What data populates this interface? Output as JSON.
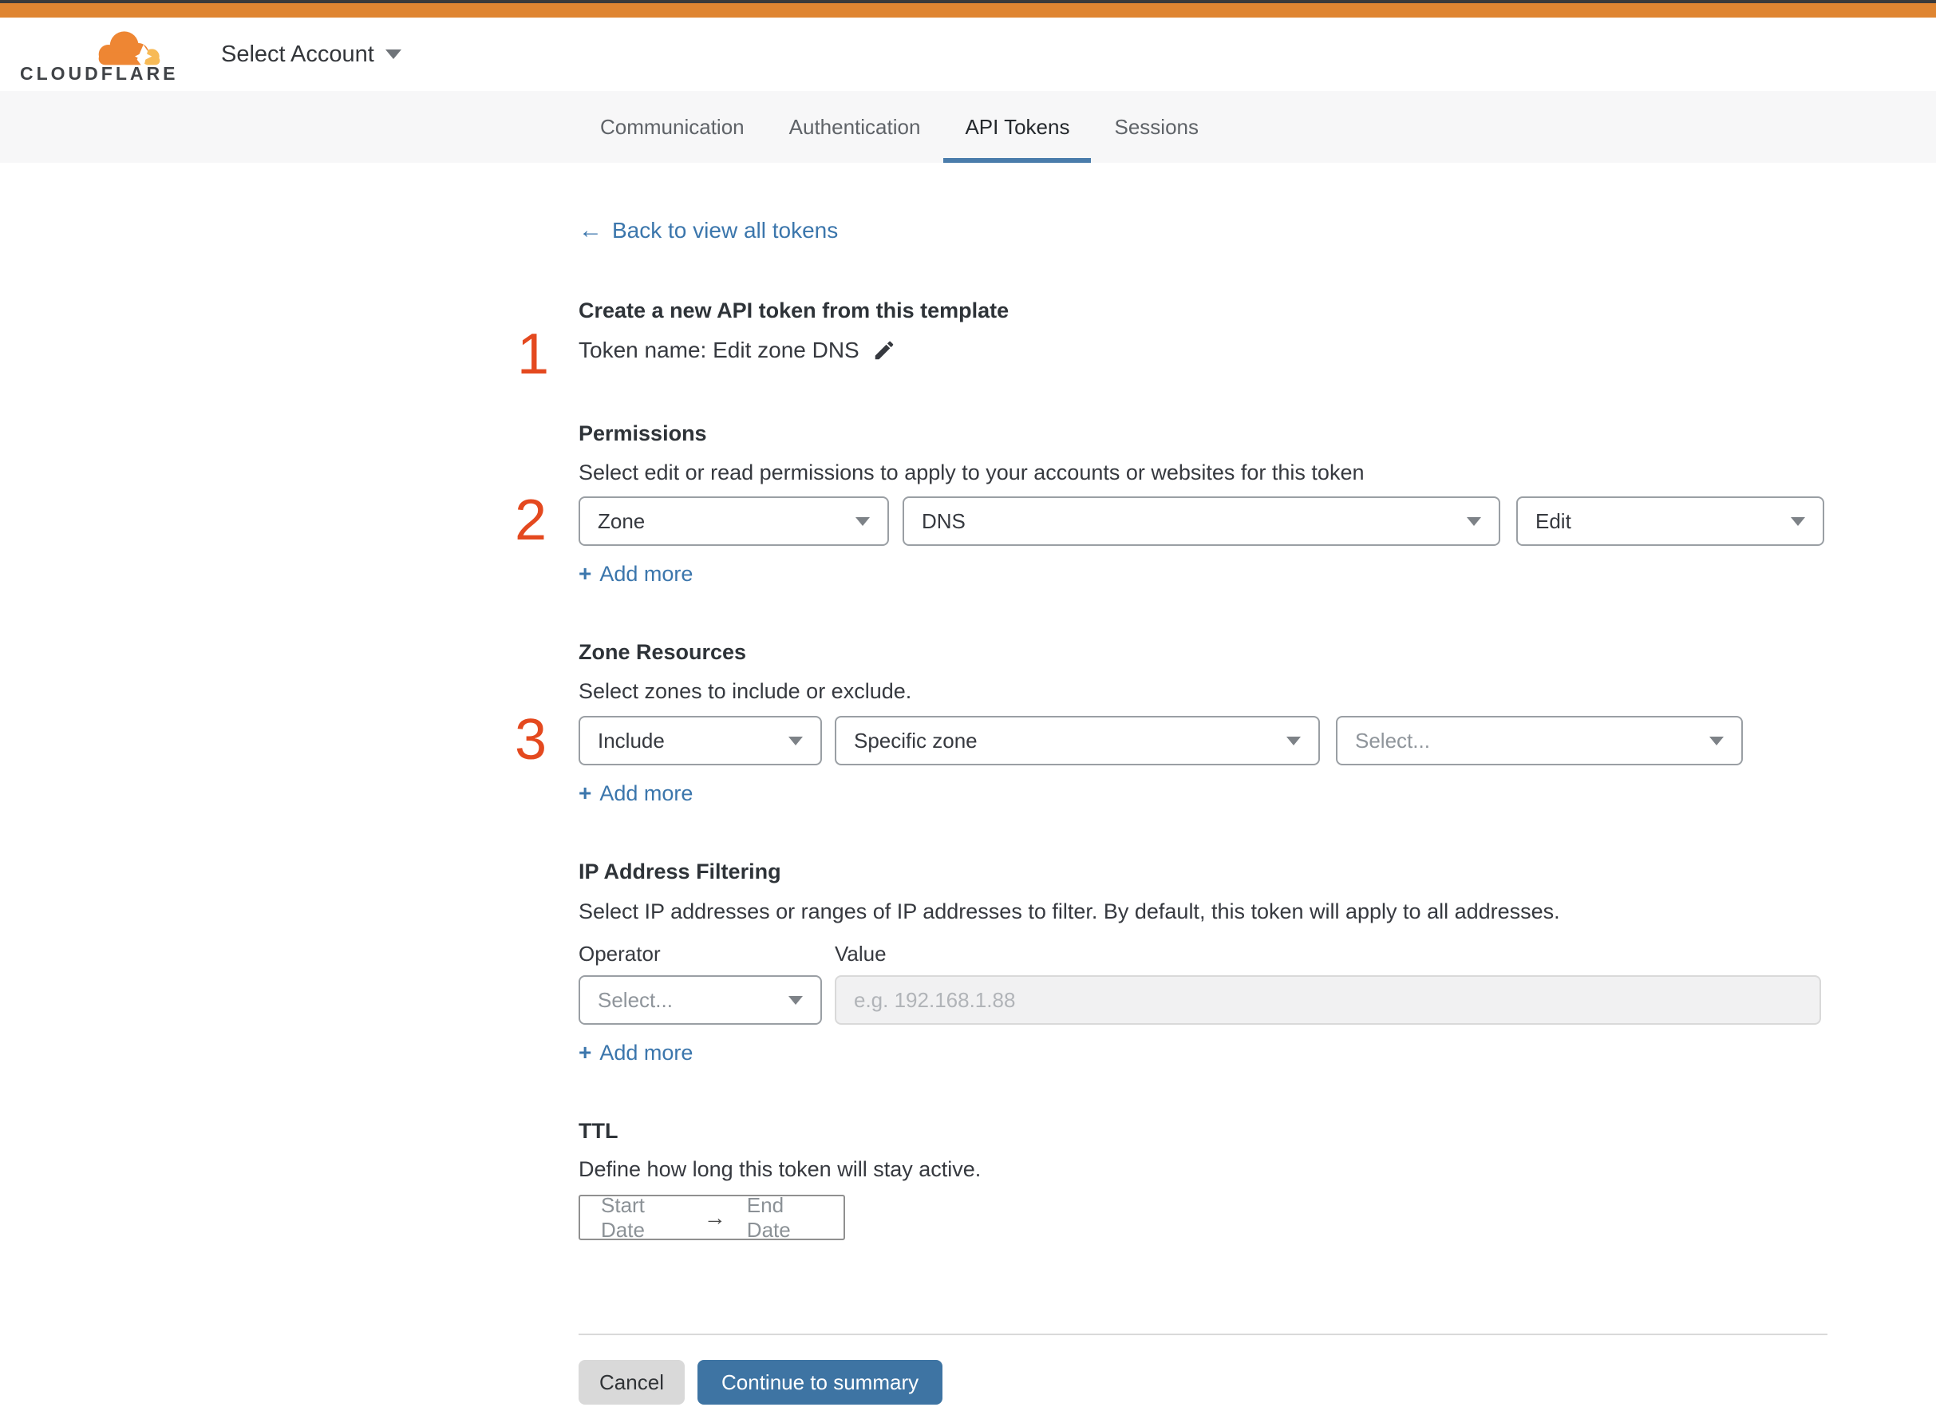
{
  "colors": {
    "topbar_orange": "#df8531",
    "logo_orange": "#ee8633",
    "logo_light_orange": "#f7ba56",
    "tab_underline_blue": "#4a7cab",
    "link_blue": "#3b76ac",
    "primary_button_blue": "#3e74a3",
    "step_number_orange": "#e4491f"
  },
  "header": {
    "logo_text": "CLOUDFLARE",
    "account_selector_label": "Select Account"
  },
  "tabs": [
    {
      "label": "Communication"
    },
    {
      "label": "Authentication"
    },
    {
      "label": "API Tokens"
    },
    {
      "label": "Sessions"
    }
  ],
  "page": {
    "back_link": {
      "arrow": "←",
      "label": "Back to view all tokens"
    },
    "add_more": {
      "icon": "+",
      "label": "Add more"
    },
    "step1": {
      "number": "1",
      "heading": "Create a new API token from this template",
      "token_name": "Token name: Edit zone DNS"
    },
    "permissions": {
      "number": "2",
      "heading": "Permissions",
      "description": "Select edit or read permissions to apply to your accounts or websites for this token",
      "selects": [
        {
          "value": "Zone"
        },
        {
          "value": "DNS"
        },
        {
          "value": "Edit"
        }
      ]
    },
    "zone_resources": {
      "number": "3",
      "heading": "Zone Resources",
      "description": "Select zones to include or exclude.",
      "selects": [
        {
          "value": "Include"
        },
        {
          "value": "Specific zone"
        },
        {
          "value": "Select..."
        }
      ]
    },
    "ip_filtering": {
      "heading": "IP Address Filtering",
      "description": "Select IP addresses or ranges of IP addresses to filter. By default, this token will apply to all addresses.",
      "operator_label": "Operator",
      "value_label": "Value",
      "operator_select": {
        "value": "Select..."
      },
      "value_placeholder": "e.g. 192.168.1.88"
    },
    "ttl": {
      "heading": "TTL",
      "description": "Define how long this token will stay active.",
      "start": "Start Date",
      "arrow": "→",
      "end": "End Date"
    },
    "footer": {
      "cancel_label": "Cancel",
      "continue_label": "Continue to summary"
    }
  }
}
